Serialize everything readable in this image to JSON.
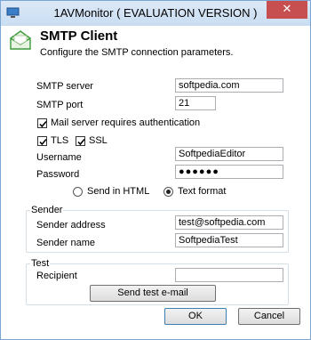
{
  "window": {
    "title": "1AVMonitor ( EVALUATION VERSION )",
    "close_glyph": "✕"
  },
  "header": {
    "title": "SMTP Client",
    "subtitle": "Configure the SMTP connection parameters.",
    "icon": "envelope-icon"
  },
  "form": {
    "smtp_server_label": "SMTP server",
    "smtp_server_value": "softpedia.com",
    "smtp_port_label": "SMTP port",
    "smtp_port_value": "21",
    "auth_label": "Mail server requires authentication",
    "auth_checked": true,
    "tls_label": "TLS",
    "tls_checked": true,
    "ssl_label": "SSL",
    "ssl_checked": true,
    "username_label": "Username",
    "username_value": "SoftpediaEditor",
    "password_label": "Password",
    "password_value": "●●●●●●",
    "send_html_label": "Send in HTML",
    "text_format_label": "Text format",
    "selected_format": "Text format"
  },
  "sender": {
    "group_title": "Sender",
    "address_label": "Sender address",
    "address_value": "test@softpedia.com",
    "name_label": "Sender name",
    "name_value": "SoftpediaTest"
  },
  "test": {
    "group_title": "Test",
    "recipient_label": "Recipient",
    "recipient_value": "",
    "send_test_label": "Send test e-mail"
  },
  "buttons": {
    "ok_label": "OK",
    "cancel_label": "Cancel"
  },
  "colors": {
    "titlebar": "#c9ddf2",
    "close": "#c74f4f",
    "envelope": "#3a9a3a"
  }
}
